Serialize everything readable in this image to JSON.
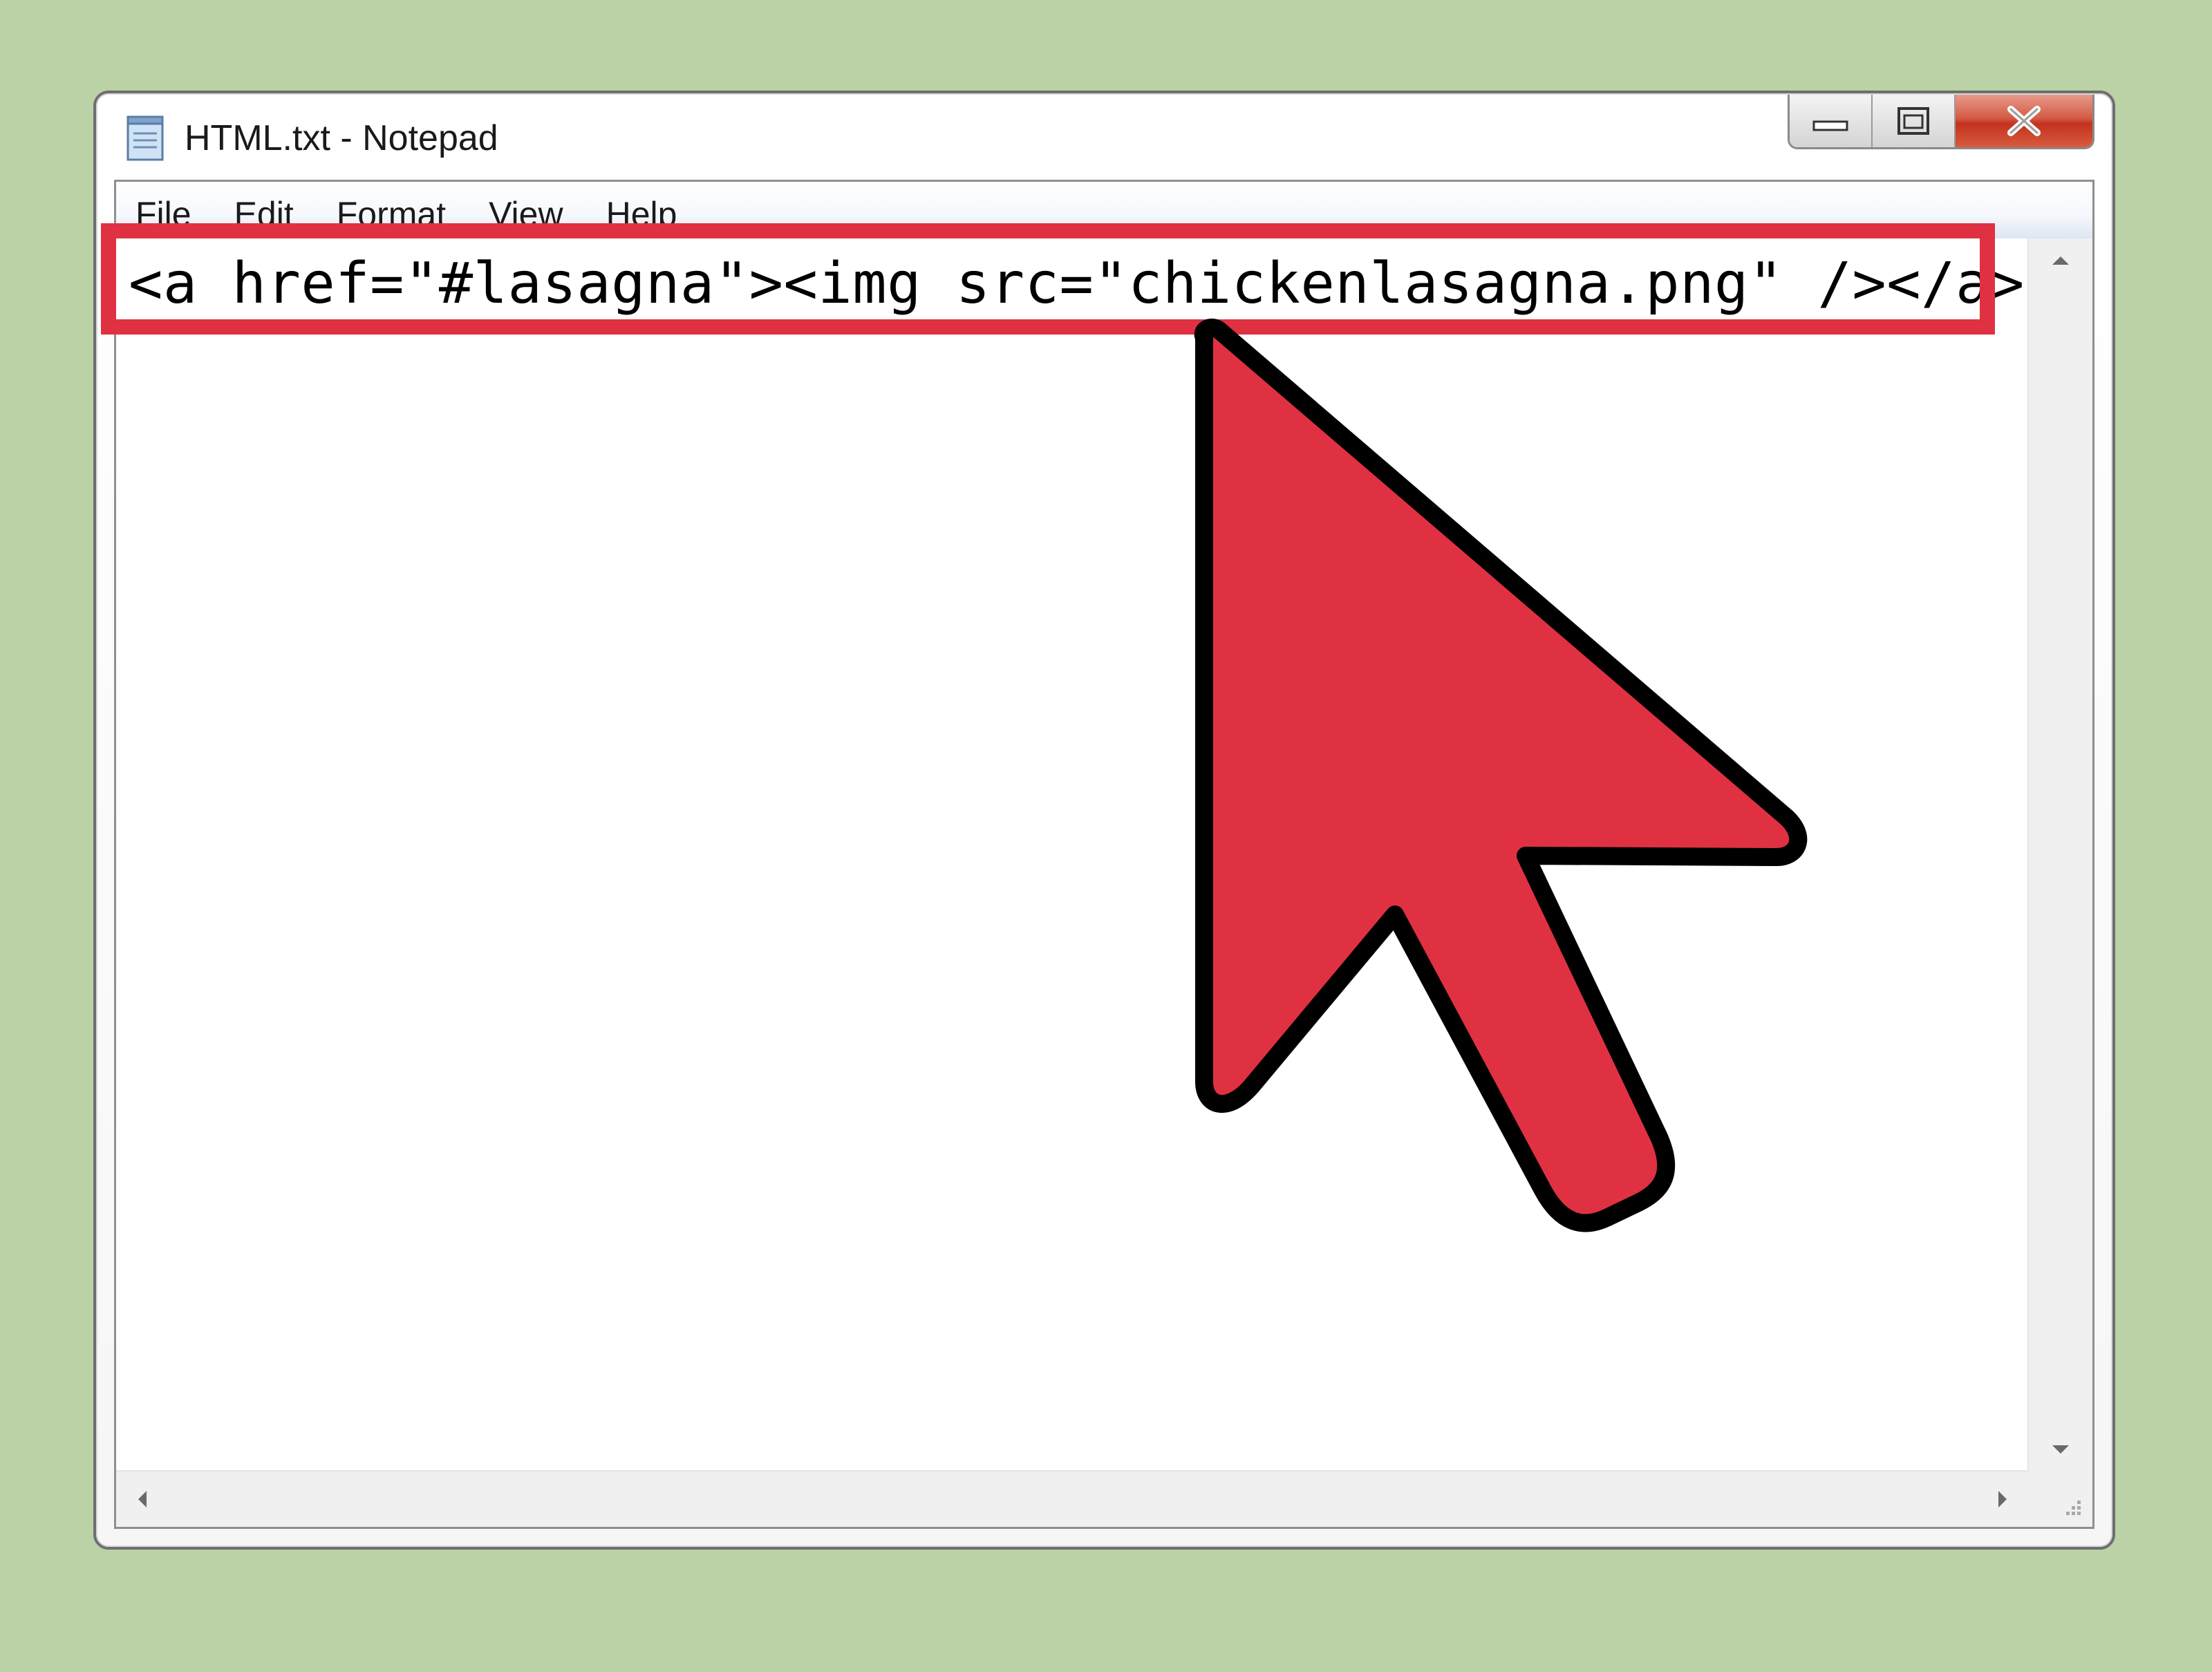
{
  "window": {
    "title": "HTML.txt - Notepad",
    "icon": "notepad-icon"
  },
  "caption_buttons": [
    {
      "name": "minimize",
      "icon": "minimize-icon"
    },
    {
      "name": "maximize",
      "icon": "maximize-icon"
    },
    {
      "name": "close",
      "icon": "close-icon"
    }
  ],
  "menu": {
    "file": "File",
    "edit": "Edit",
    "format": "Format",
    "view": "View",
    "help": "Help"
  },
  "editor": {
    "line1": "<a href=\"#lasagna\"><img src=\"chickenlasagna.png\" /></a>"
  },
  "annotation": {
    "highlight_color": "#e03143",
    "cursor_color": "#e03143",
    "cursor_icon": "mouse-pointer-icon"
  },
  "colors": {
    "background": "#bad2a6"
  }
}
